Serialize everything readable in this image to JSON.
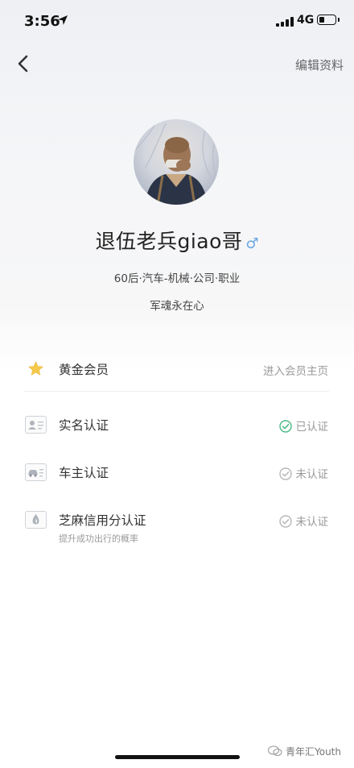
{
  "status_bar": {
    "time": "3:56",
    "network": "4G",
    "battery_level": 0.35
  },
  "nav": {
    "edit_label": "编辑资料"
  },
  "profile": {
    "name": "退伍老兵giao哥",
    "gender_symbol": "♂",
    "tags": "60后·汽车-机械·公司·职业",
    "motto": "军魂永在心"
  },
  "items": [
    {
      "label": "黄金会员",
      "right": "进入会员主页"
    },
    {
      "label": "实名认证",
      "right": "已认证"
    },
    {
      "label": "车主认证",
      "right": "未认证"
    },
    {
      "label": "芝麻信用分认证",
      "right": "未认证",
      "sub": "提升成功出行的概率"
    }
  ],
  "colors": {
    "verified": "#48b883",
    "unverified": "#b7b7b7",
    "star": "#f5c84a",
    "gender": "#6aa7e3"
  },
  "watermark": "青年汇Youth"
}
